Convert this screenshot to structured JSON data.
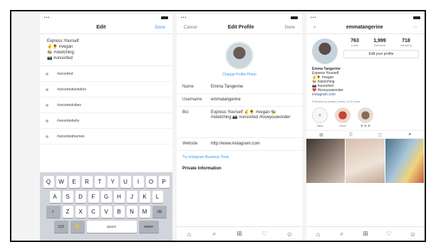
{
  "phone1": {
    "nav": {
      "title": "Edit",
      "right": "Done"
    },
    "bio_lines": [
      "Express Yourself",
      "✌️🌻 #vegan",
      "🐝 #sketching",
      "📷 #unsorted"
    ],
    "tag_items": [
      {
        "line1": "#unsorted",
        "line2": ""
      },
      {
        "line1": "#unsortedwonders",
        "line2": ""
      },
      {
        "line1": "#unsortedvibes",
        "line2": ""
      },
      {
        "line1": "#unsortedwho",
        "line2": ""
      },
      {
        "line1": "#unsortedmemes",
        "line2": ""
      }
    ],
    "keyboard": {
      "row1": [
        "Q",
        "W",
        "E",
        "R",
        "T",
        "Y",
        "U",
        "I",
        "O",
        "P"
      ],
      "row2": [
        "A",
        "S",
        "D",
        "F",
        "G",
        "H",
        "J",
        "K",
        "L"
      ],
      "row3": [
        "⇧",
        "Z",
        "X",
        "C",
        "V",
        "B",
        "N",
        "M",
        "⌫"
      ],
      "row4": [
        "123",
        "🙂",
        "space",
        "return"
      ]
    }
  },
  "phone2": {
    "nav": {
      "left": "Cancel",
      "title": "Edit Profile",
      "right": "Done"
    },
    "change_photo": "Change Profile Photo",
    "fields": [
      {
        "label": "Name",
        "value": "Emma Tangerine"
      },
      {
        "label": "Username",
        "value": "emmatangerine"
      },
      {
        "label": "Bio",
        "value": "Express Yourself ✌️🌻 #vegan 🐝 #sketching 📷 #unsorted #loveyouwonder"
      },
      {
        "label": "Website",
        "value": "http://www.instagram.com"
      }
    ],
    "switch_link": "Try Instagram Business Tools",
    "private_head": "Private Information"
  },
  "phone3": {
    "nav": {
      "left": "<",
      "title": "emmatangerine",
      "right": "⋯"
    },
    "stats": [
      {
        "num": "763",
        "label": "posts"
      },
      {
        "num": "1,999",
        "label": "followers"
      },
      {
        "num": "718",
        "label": "following"
      }
    ],
    "edit_label": "Edit your profile",
    "bio": {
      "name": "Emma Tangerine",
      "lines": [
        "Express Yourself",
        "✌️🌻 #vegan",
        "🐝 #sketching",
        "📷 #unsorted",
        "❤️ #loveyouwonder"
      ],
      "link": "instagram.com"
    },
    "followed": "Followed by bellas_mama, et 33 more",
    "highlights": [
      {
        "label": "New",
        "icon": "+"
      },
      {
        "label": "Food",
        "icon": ""
      },
      {
        "label": "☕☕☕",
        "icon": ""
      }
    ]
  }
}
